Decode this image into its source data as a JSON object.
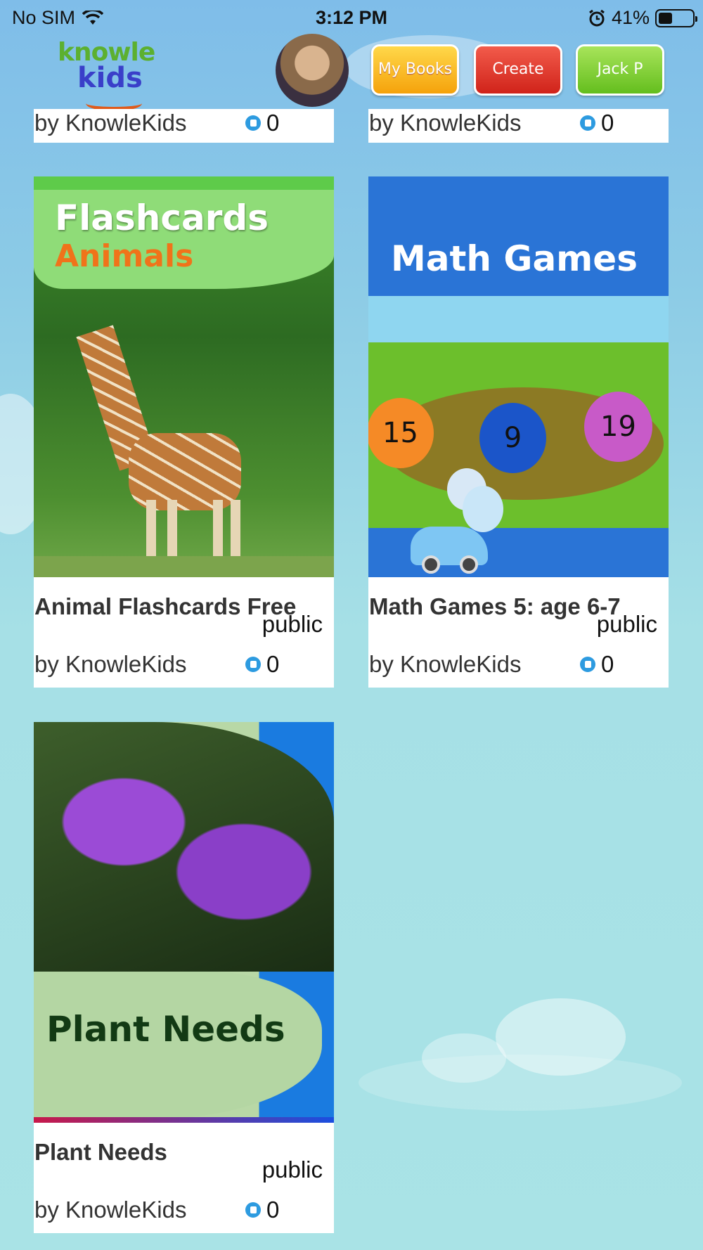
{
  "status_bar": {
    "carrier": "No SIM",
    "time": "3:12 PM",
    "battery": "41%",
    "battery_level": 0.41
  },
  "header": {
    "logo_line1": "knowle",
    "logo_line2": "kids",
    "my_books_label": "My Books",
    "create_label": "Create",
    "user_label": "Jack P"
  },
  "partial_cards": [
    {
      "author": "by KnowleKids",
      "likes": "0"
    },
    {
      "author": "by KnowleKids",
      "likes": "0"
    }
  ],
  "cards": [
    {
      "title": "Animal Flashcards Free",
      "visibility": "public",
      "author": "by KnowleKids",
      "likes": "0",
      "cover_line1": "Flashcards",
      "cover_line2": "Animals"
    },
    {
      "title": "Math Games 5: age 6-7",
      "visibility": "public",
      "author": "by KnowleKids",
      "likes": "0",
      "cover_title": "Math Games",
      "balloons": [
        "15",
        "9",
        "19"
      ]
    },
    {
      "title": "Plant Needs",
      "visibility": "public",
      "author": "by KnowleKids",
      "likes": "0",
      "cover_title": "Plant Needs"
    }
  ],
  "colors": {
    "accent_blue": "#2d9be0",
    "my_books": "#f5a20b",
    "create": "#d0231a",
    "user": "#64be1e"
  }
}
